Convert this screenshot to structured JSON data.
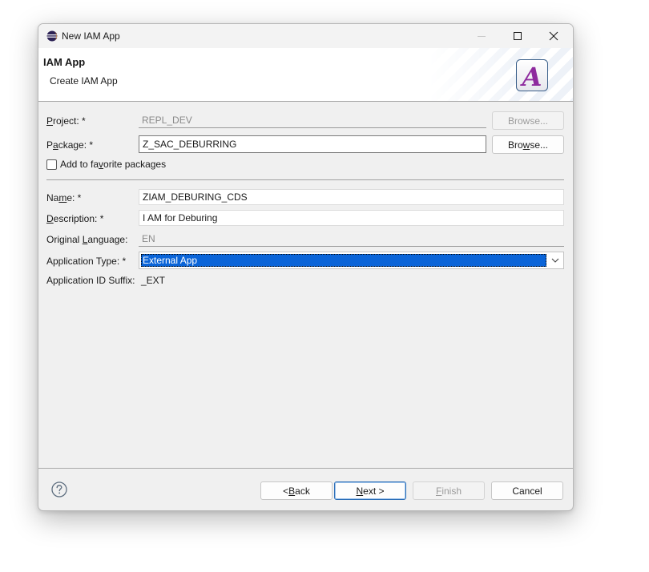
{
  "window": {
    "title": "New IAM App",
    "icon": "eclipse-icon"
  },
  "banner": {
    "title": "IAM App",
    "subtitle": "Create IAM App",
    "logo_letter": "A"
  },
  "form": {
    "project": {
      "label_pre": "",
      "label_key": "P",
      "label_post": "roject: *",
      "value": "REPL_DEV",
      "browse_pre": "Browse...",
      "browse_key": "",
      "browse_post": ""
    },
    "package": {
      "label_pre": "P",
      "label_key": "a",
      "label_post": "ckage: *",
      "value": "Z_SAC_DEBURRING",
      "browse_pre": "Bro",
      "browse_key": "w",
      "browse_post": "se..."
    },
    "favorite": {
      "label_pre": "Add to fa",
      "label_key": "v",
      "label_post": "orite packages",
      "checked": false
    },
    "name": {
      "label_pre": "Na",
      "label_key": "m",
      "label_post": "e: *",
      "value": "ZIAM_DEBURING_CDS"
    },
    "description": {
      "label_pre": "",
      "label_key": "D",
      "label_post": "escription: *",
      "value": "I AM for Deburing"
    },
    "original_language": {
      "label_pre": "Original ",
      "label_key": "L",
      "label_post": "anguage:",
      "value": "EN"
    },
    "application_type": {
      "label": "Application Type: *",
      "value": "External App"
    },
    "application_id_suffix": {
      "label": "Application ID Suffix:",
      "value": "_EXT"
    }
  },
  "footer": {
    "back": {
      "pre": "< ",
      "key": "B",
      "post": "ack"
    },
    "next": {
      "pre": "",
      "key": "N",
      "post": "ext >"
    },
    "finish": {
      "pre": "",
      "key": "F",
      "post": "inish"
    },
    "cancel": "Cancel"
  },
  "colors": {
    "selection": "#0a64d8",
    "default_button_border": "#2d6fb8",
    "logo_letter": "#8e2a9e"
  }
}
